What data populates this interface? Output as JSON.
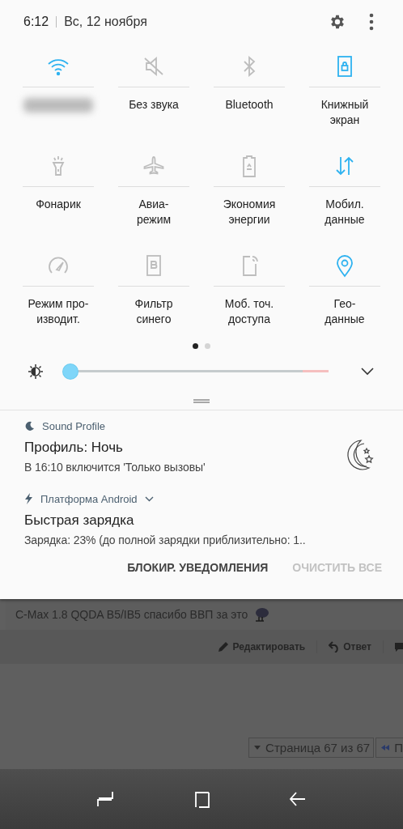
{
  "status": {
    "time": "6:12",
    "date": "Вс, 12 ноября"
  },
  "tiles": [
    {
      "kind": "wifi",
      "blurred": true,
      "on": true
    },
    {
      "kind": "mute",
      "label": "Без звука",
      "on": false
    },
    {
      "kind": "bluetooth",
      "label": "Bluetooth",
      "on": false
    },
    {
      "kind": "portrait",
      "label": "Книжный\nэкран",
      "on": true
    },
    {
      "kind": "flashlight",
      "label": "Фонарик",
      "on": false
    },
    {
      "kind": "airplane",
      "label": "Авиа-\nрежим",
      "on": false
    },
    {
      "kind": "battery",
      "label": "Экономия\nэнергии",
      "on": false
    },
    {
      "kind": "data",
      "label": "Мобил.\nданные",
      "on": true
    },
    {
      "kind": "gauge",
      "label": "Режим про-\nизводит.",
      "on": false
    },
    {
      "kind": "bluefilter",
      "label": "Фильтр\nсинего",
      "on": false
    },
    {
      "kind": "hotspot",
      "label": "Моб. точ.\nдоступа",
      "on": false
    },
    {
      "kind": "location",
      "label": "Гео-\nданные",
      "on": true
    }
  ],
  "pages": [
    {
      "selected": true
    },
    {
      "selected": false
    }
  ],
  "brightness": {
    "level": 0.0
  },
  "notifications": [
    {
      "kind": "moon",
      "app": "Sound Profile",
      "title": "Профиль: Ночь",
      "text": "В 16:10 включится 'Только вызовы'",
      "expandable": false
    },
    {
      "kind": "bolt",
      "app": "Платформа Android",
      "title": "Быстрая зарядка",
      "text": "Зарядка: 23% (до полной зарядки приблизительно: 1..",
      "expandable": true
    }
  ],
  "actions": [
    {
      "label": "БЛОКИР. УВЕДОМЛЕНИЯ",
      "disabled": false
    },
    {
      "label": "ОЧИСТИТЬ ВСЕ",
      "disabled": true
    }
  ],
  "background_page": {
    "post_text": "C-Max 1.8 QQDA B5/IB5 спасибо ВВП за это",
    "edit": "Редактировать",
    "reply": "Ответ",
    "pager": "Страница 67 из 67",
    "pager_next": "П"
  }
}
